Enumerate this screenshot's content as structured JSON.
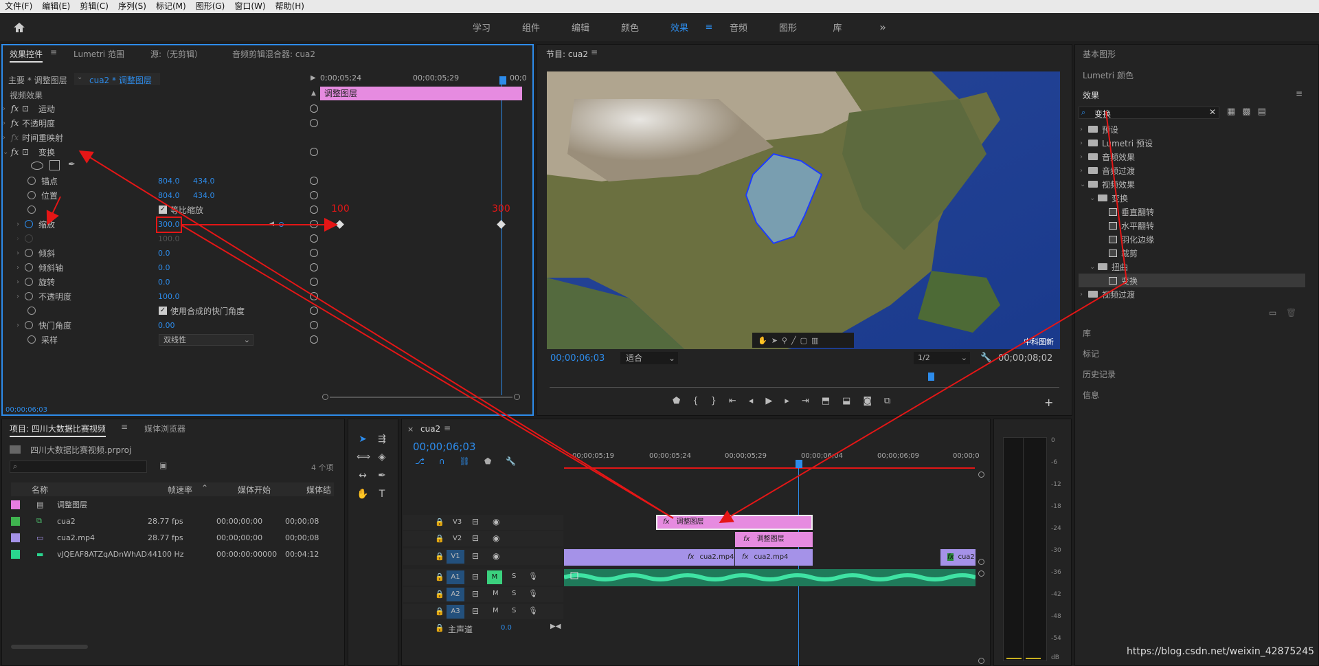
{
  "menu": [
    "文件(F)",
    "编辑(E)",
    "剪辑(C)",
    "序列(S)",
    "标记(M)",
    "图形(G)",
    "窗口(W)",
    "帮助(H)"
  ],
  "workspaces": [
    "学习",
    "组件",
    "编辑",
    "颜色",
    "效果",
    "音频",
    "图形",
    "库"
  ],
  "workspace_active": "效果",
  "effect_controls": {
    "tabs": [
      "效果控件",
      "Lumetri 范围",
      "源:（无剪辑）",
      "音频剪辑混合器: cua2"
    ],
    "master": "主要 * 调整图层",
    "sequence_clip": "cua2 * 调整图层",
    "time_left": "0;00;05;24",
    "time_mid": "00;00;05;29",
    "time_right": "00;0",
    "section": "视频效果",
    "clip_bar_label": "调整图层",
    "effects": [
      "运动",
      "不透明度",
      "时间重映射",
      "变换"
    ],
    "props": {
      "anchor": {
        "label": "锚点",
        "x": "804.0",
        "y": "434.0"
      },
      "position": {
        "label": "位置",
        "x": "804.0",
        "y": "434.0"
      },
      "uniform": "等比缩放",
      "scale": {
        "label": "缩放",
        "value": "300.0"
      },
      "scale_width": "100.0",
      "skew": {
        "label": "倾斜",
        "value": "0.0"
      },
      "skew_axis": {
        "label": "倾斜轴",
        "value": "0.0"
      },
      "rotation": {
        "label": "旋转",
        "value": "0.0"
      },
      "opacity": {
        "label": "不透明度",
        "value": "100.0"
      },
      "comp_shutter": "使用合成的快门角度",
      "shutter": {
        "label": "快门角度",
        "value": "0.00"
      },
      "sampling": {
        "label": "采样",
        "value": "双线性"
      }
    },
    "kf_label_1": "100",
    "kf_label_2": "300",
    "timecode": "00;00;06;03"
  },
  "program": {
    "title": "节目: cua2",
    "timecode": "00;00;06;03",
    "fit": "适合",
    "quality": "1/2",
    "duration": "00;00;08;02",
    "watermark": "中科图新"
  },
  "right_panel": {
    "basic_graphics": "基本图形",
    "lumetri": "Lumetri 颜色",
    "effects_title": "效果",
    "search_value": "变换",
    "tree": [
      "预设",
      "Lumetri 预设",
      "音频效果",
      "音频过渡",
      "视频效果",
      "变换",
      "垂直翻转",
      "水平翻转",
      "羽化边缘",
      "裁剪",
      "扭曲",
      "变换",
      "视频过渡"
    ],
    "lower": [
      "库",
      "标记",
      "历史记录",
      "信息"
    ]
  },
  "project": {
    "tabs": [
      "项目: 四川大数据比赛视频",
      "媒体浏览器"
    ],
    "file": "四川大数据比赛视频.prproj",
    "count": "4 个项",
    "cols": [
      "名称",
      "帧速率",
      "媒体开始",
      "媒体结"
    ],
    "rows": [
      {
        "color": "#e77de0",
        "name": "调整图层",
        "fps": "",
        "start": "",
        "end": ""
      },
      {
        "color": "#3fb34f",
        "name": "cua2",
        "fps": "28.77 fps",
        "start": "00;00;00;00",
        "end": "00;00;08"
      },
      {
        "color": "#a592e8",
        "name": "cua2.mp4",
        "fps": "28.77 fps",
        "start": "00;00;00;00",
        "end": "00;00;08"
      },
      {
        "color": "#2ad48e",
        "name": "vJQEAF8ATZqADnWhAD2G",
        "fps": "44100 Hz",
        "start": "00:00:00:00000",
        "end": "00:04:12"
      }
    ]
  },
  "timeline": {
    "tab": "cua2",
    "timecode": "00;00;06;03",
    "ruler": [
      "00;00;05;19",
      "00;00;05;24",
      "00;00;05;29",
      "00;00;06;04",
      "00;00;06;09",
      "00;00;0"
    ],
    "tracks_video": [
      "V3",
      "V2",
      "V1"
    ],
    "tracks_audio": [
      "A1",
      "A2",
      "A3"
    ],
    "master": "主声道",
    "master_value": "0.0",
    "clip_v3": "调整图层",
    "clip_v2": "调整图层",
    "clip_v1a": "cua2.mp4",
    "clip_v1b": "cua2.mp4",
    "clip_v1c": "cua2",
    "btn_m": "M",
    "btn_s": "S"
  },
  "meter": [
    "0",
    "-6",
    "-12",
    "-18",
    "-24",
    "-30",
    "-36",
    "-42",
    "-48",
    "-54",
    "dB"
  ],
  "watermark_url": "https://blog.csdn.net/weixin_42875245"
}
